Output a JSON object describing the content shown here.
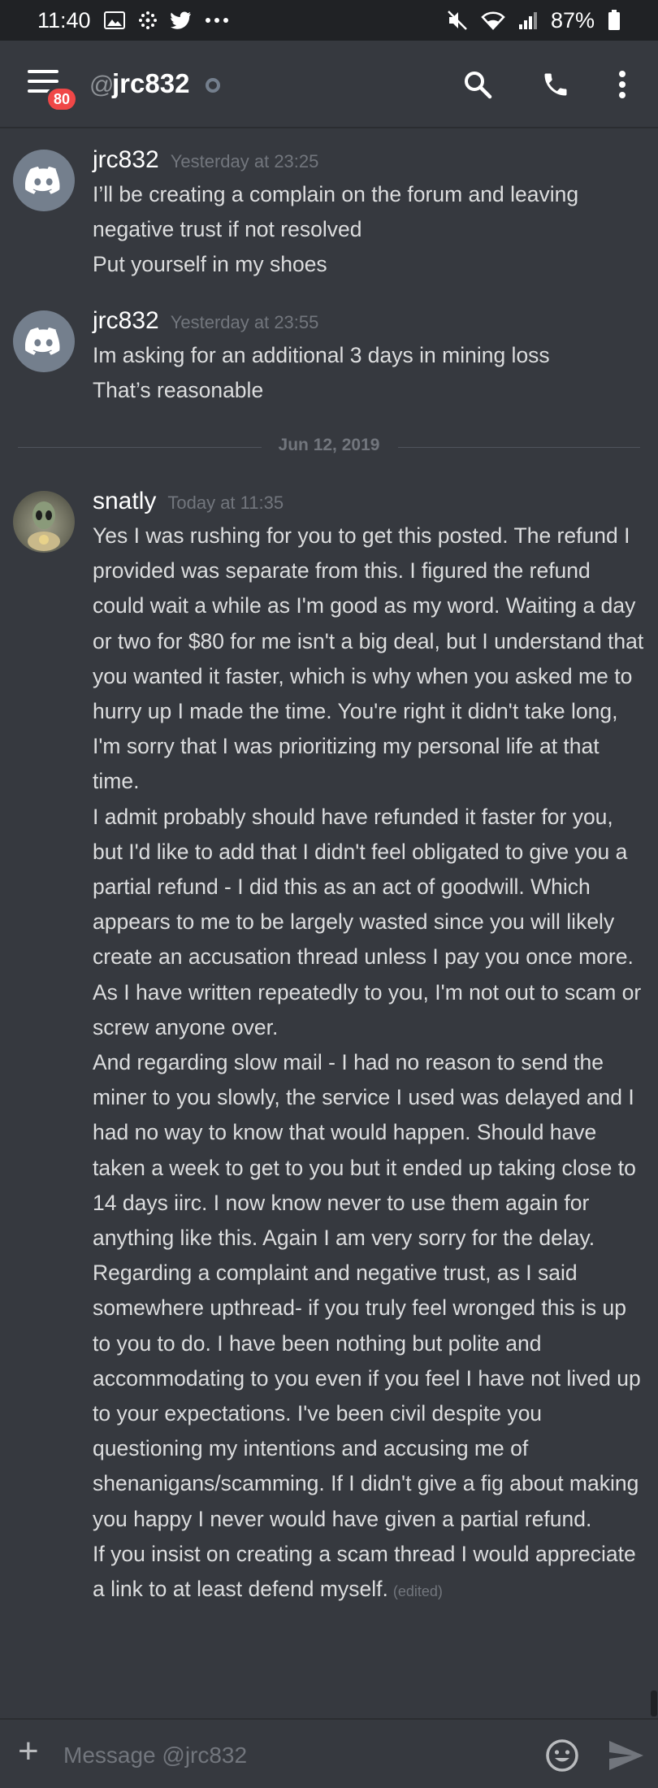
{
  "status_bar": {
    "time": "11:40",
    "battery": "87%"
  },
  "header": {
    "at_symbol": "@",
    "username": "jrc832",
    "badge_count": "80"
  },
  "messages": [
    {
      "author": "jrc832",
      "timestamp": "Yesterday at 23:25",
      "lines": [
        "I’ll be creating a complain on the forum and leaving negative trust if not resolved",
        "Put yourself in my shoes"
      ]
    },
    {
      "author": "jrc832",
      "timestamp": "Yesterday at 23:55",
      "lines": [
        "Im asking for an additional 3 days in mining loss",
        "That’s reasonable"
      ]
    },
    {
      "author": "snatly",
      "timestamp": "Today at 11:35",
      "edited": "(edited)",
      "lines": [
        "Yes I was rushing for you to get this posted. The refund I provided was separate from this. I figured the refund could wait a while as I'm good as my word. Waiting a day or two for $80 for me isn't a big deal, but I understand that you wanted it faster, which is why when you asked me to hurry up I made the time. You're right it didn't take long, I'm sorry that I was prioritizing my personal life at that time.",
        "I admit probably should have refunded it faster for you, but I'd like to add that I didn't feel obligated to give you a partial refund - I did this as an act of goodwill. Which appears to me to be largely wasted since you will likely create an accusation thread unless I pay you once more. As I have written repeatedly to you, I'm not out to scam or screw anyone over.",
        "And regarding slow mail - I had no reason to send the miner to you slowly, the service I used was delayed and I had no way to know that would happen. Should have taken a week to get to you but it ended up taking close to 14 days iirc. I now know never to use them again for anything like this. Again I am very sorry for the delay.",
        "Regarding a complaint and negative trust, as I said somewhere upthread- if you truly feel wronged this is up to you to do. I have been nothing but polite and accommodating to you even if you feel I have not lived up to your expectations. I've been civil despite you questioning my intentions and accusing me of shenanigans/scamming. If I didn't give a fig about making you happy I never would have given a partial refund.",
        "If you insist on creating a scam thread I would appreciate a link to at least defend myself."
      ]
    }
  ],
  "date_divider": "Jun 12, 2019",
  "composer": {
    "placeholder": "Message @jrc832"
  },
  "colors": {
    "background": "#36393f",
    "status_bar": "#202225",
    "badge": "#f04747",
    "text": "#dcddde",
    "muted": "#72767d"
  },
  "icons": [
    "picture-icon",
    "grid-icon",
    "twitter-icon",
    "more-icon",
    "mute-icon",
    "wifi-icon",
    "signal-icon",
    "battery-icon",
    "hamburger-icon",
    "status-offline-icon",
    "search-icon",
    "phone-icon",
    "kebab-icon",
    "discord-logo-icon",
    "plus-icon",
    "emoji-icon",
    "send-icon"
  ]
}
